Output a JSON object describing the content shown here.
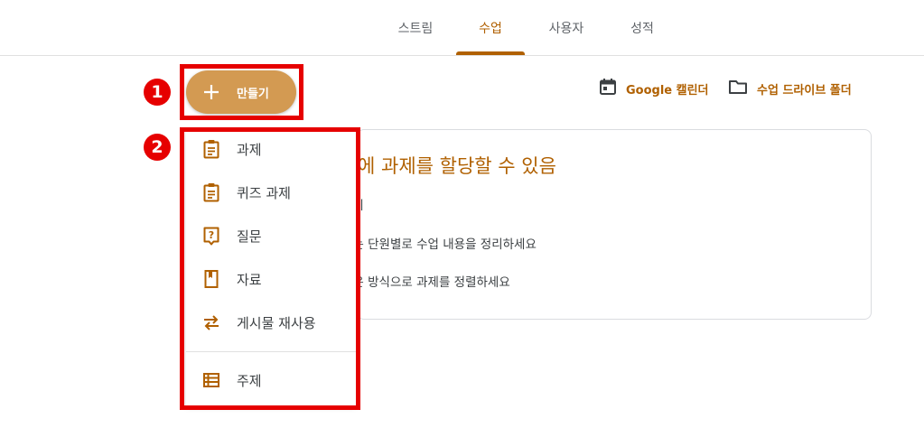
{
  "tabs": [
    {
      "label": "스트림"
    },
    {
      "label": "수업",
      "active": true
    },
    {
      "label": "사용자"
    },
    {
      "label": "성적"
    }
  ],
  "create_button": {
    "label": "만들기",
    "icon": "plus-icon"
  },
  "links": {
    "calendar": {
      "label": "Google 캘린더",
      "icon": "calendar-icon"
    },
    "drive": {
      "label": "수업 드라이브 폴더",
      "icon": "folder-icon"
    }
  },
  "card": {
    "title": "에 과제를 할당할 수 있음",
    "lines": [
      "보기",
      "또는 단원별로 수업 내용을 정리하세요",
      "싶은 방식으로 과제를 정렬하세요"
    ]
  },
  "menu": {
    "items": [
      {
        "label": "과제",
        "icon": "assignment-icon"
      },
      {
        "label": "퀴즈 과제",
        "icon": "quiz-assignment-icon"
      },
      {
        "label": "질문",
        "icon": "question-icon"
      },
      {
        "label": "자료",
        "icon": "material-icon"
      },
      {
        "label": "게시물 재사용",
        "icon": "reuse-post-icon"
      },
      {
        "label": "주제",
        "icon": "topic-icon"
      }
    ]
  },
  "annotations": {
    "badge1": "1",
    "badge2": "2"
  },
  "colors": {
    "accent": "#b06000",
    "button": "#d39a52",
    "annotation": "#e60000"
  }
}
